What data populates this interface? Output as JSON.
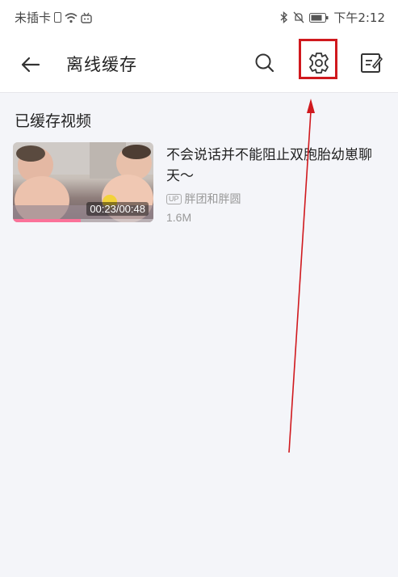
{
  "status_bar": {
    "carrier": "未插卡",
    "time": "下午2:12"
  },
  "toolbar": {
    "title": "离线缓存",
    "icons": [
      "back-arrow-icon",
      "search-icon",
      "settings-icon",
      "edit-icon"
    ]
  },
  "section": {
    "title": "已缓存视频"
  },
  "videos": [
    {
      "title": "不会说话并不能阻止双胞胎幼崽聊天～",
      "duration": "00:23/00:48",
      "progress": 0.48,
      "uploader_badge": "UP",
      "uploader": "胖团和胖圆",
      "size": "1.6M"
    }
  ],
  "colors": {
    "highlight": "#d0191e",
    "progress": "#fb7299",
    "background": "#f4f5f9"
  }
}
